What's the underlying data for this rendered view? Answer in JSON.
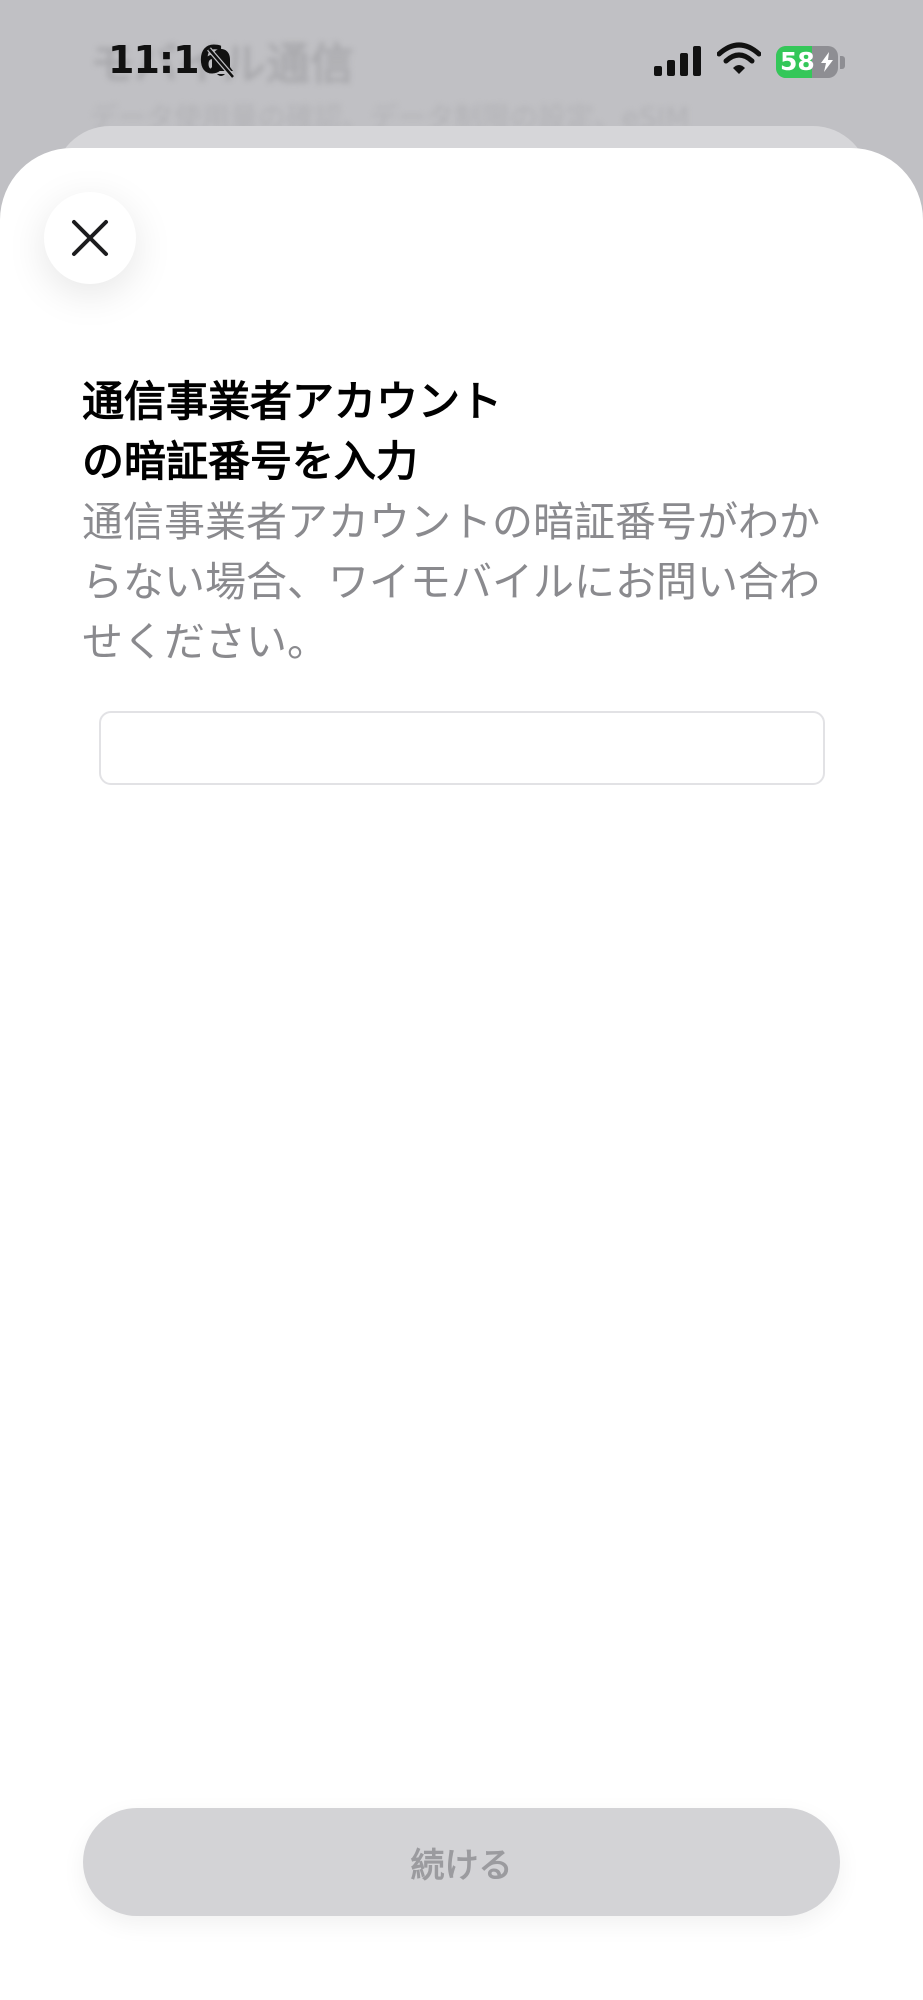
{
  "background": {
    "title": "モバイル通信",
    "subtitle": "データ使用量の確認、データ制限の設定、eSIM"
  },
  "status_bar": {
    "time": "11:16",
    "battery_level": "58",
    "battery_fraction": 0.58,
    "icons": [
      "bell-slash-icon",
      "signal-icon",
      "wifi-icon",
      "battery-charging-icon"
    ]
  },
  "sheet": {
    "close_icon": "close-icon",
    "title_line1": "通信事業者アカウント",
    "title_line2": "の暗証番号を入力",
    "description": "通信事業者アカウントの暗証番号がわからない場合、ワイモバイルにお問い合わせください。",
    "pin_value": "",
    "continue_label": "続ける"
  },
  "colors": {
    "sheet_background": "#ffffff",
    "description_text": "#8a8a8e",
    "button_disabled_bg": "#d3d3d6",
    "button_disabled_text": "#9b9b9f",
    "battery_green": "#34c759"
  }
}
